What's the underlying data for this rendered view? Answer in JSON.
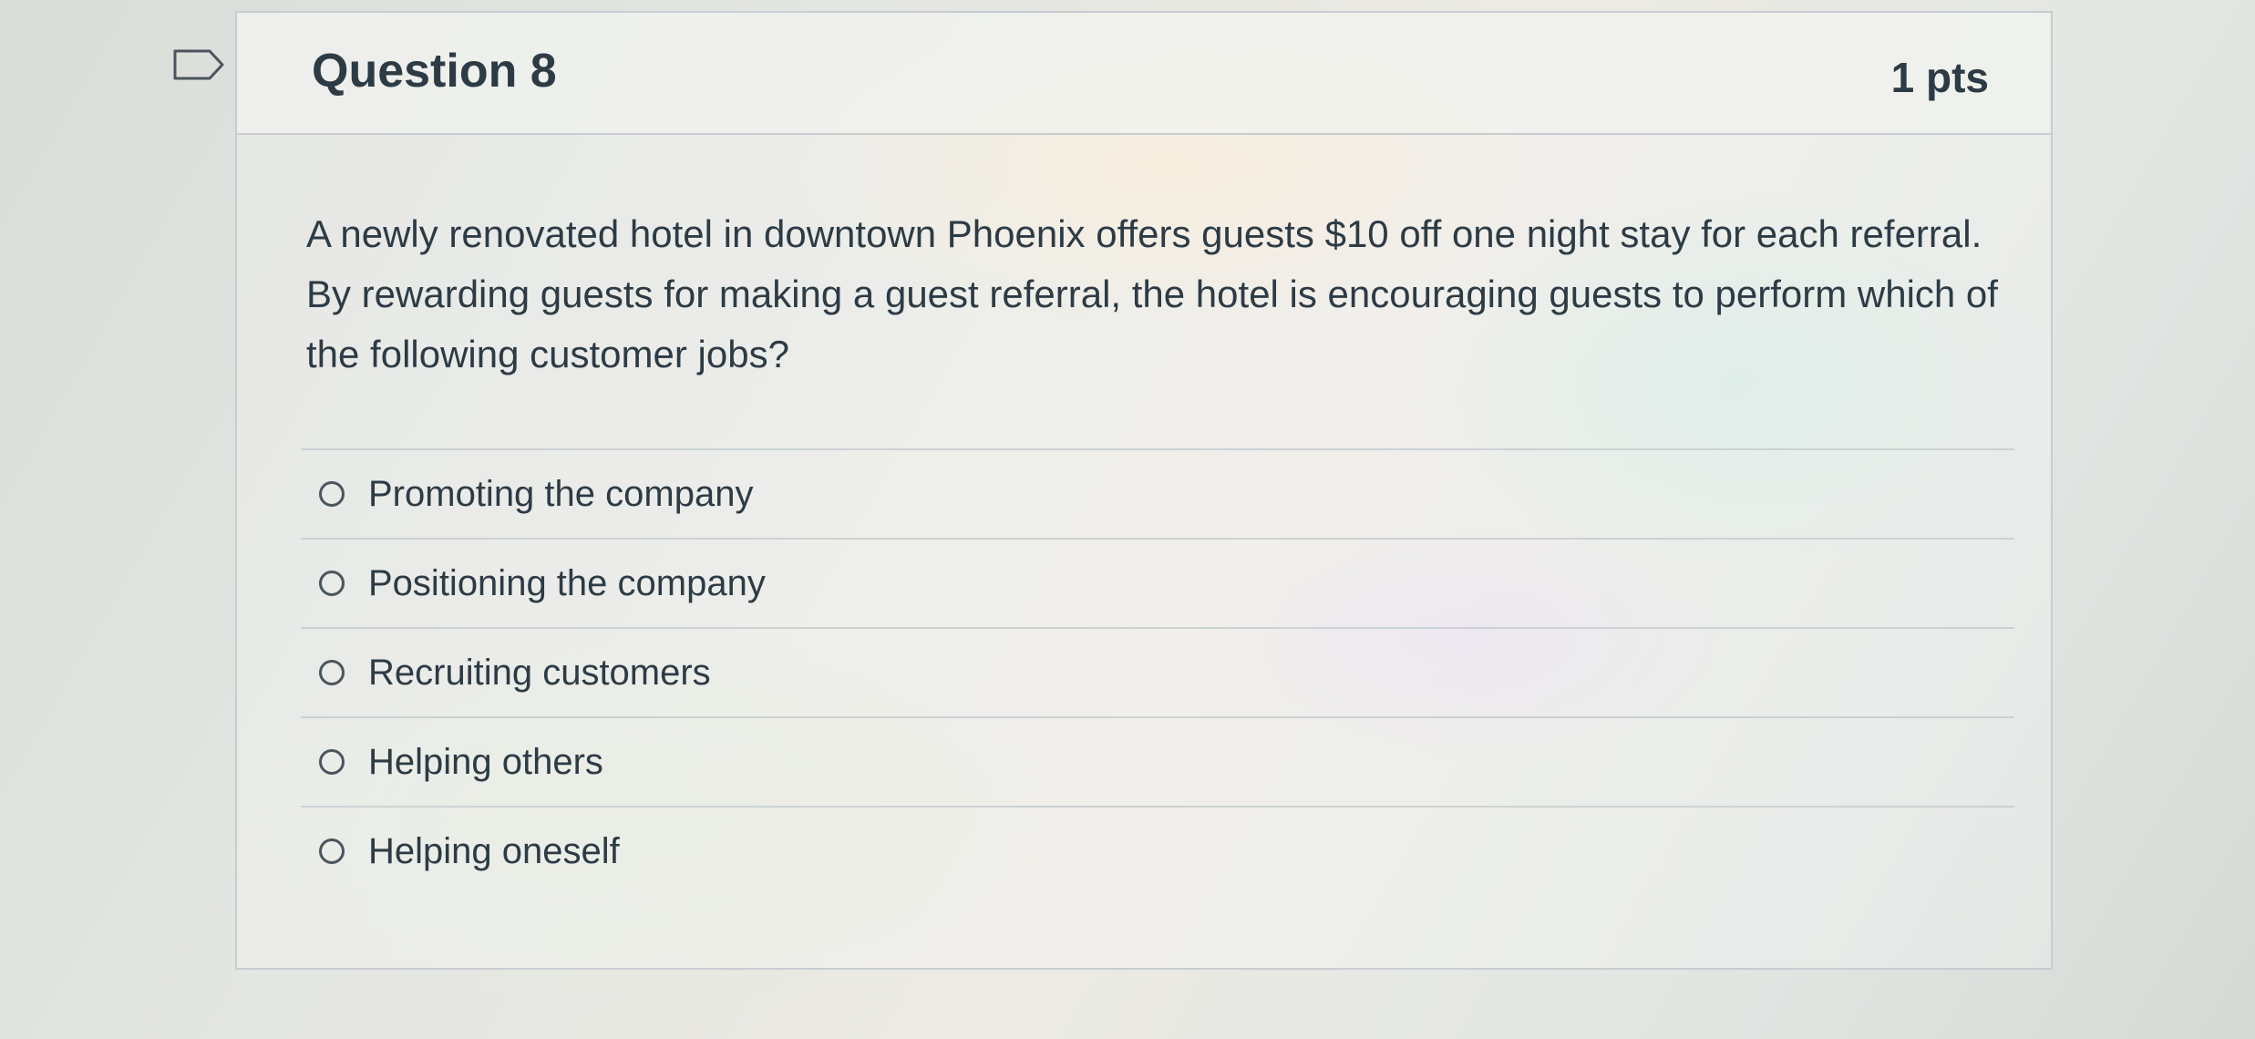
{
  "question": {
    "title": "Question 8",
    "points": "1 pts",
    "text": "A newly renovated hotel in downtown Phoenix offers guests $10 off one night stay for each referral. By rewarding guests for making a guest referral, the hotel is encouraging guests to perform which of the following customer jobs?",
    "selected": null
  },
  "answers": [
    {
      "label": "Promoting the company"
    },
    {
      "label": "Positioning the company"
    },
    {
      "label": "Recruiting customers"
    },
    {
      "label": "Helping others"
    },
    {
      "label": "Helping oneself"
    }
  ],
  "icons": {
    "flag": "bookmark-flag-icon"
  },
  "colors": {
    "text": "#2d3b45",
    "border": "#c7cdd1"
  }
}
